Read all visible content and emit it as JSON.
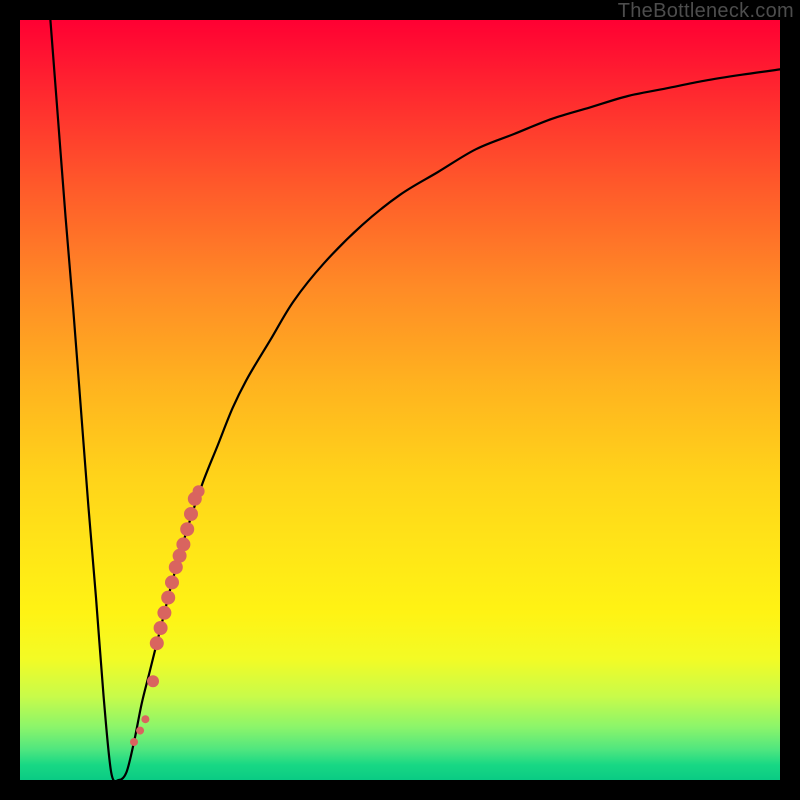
{
  "watermark": "TheBottleneck.com",
  "chart_data": {
    "type": "line",
    "title": "",
    "xlabel": "",
    "ylabel": "",
    "xlim": [
      0,
      100
    ],
    "ylim": [
      0,
      100
    ],
    "x": [
      4,
      5,
      6,
      7,
      8,
      9,
      10,
      11,
      12,
      13,
      14,
      15,
      16,
      17,
      18,
      19,
      20,
      22,
      24,
      26,
      28,
      30,
      33,
      36,
      40,
      45,
      50,
      55,
      60,
      65,
      70,
      75,
      80,
      85,
      90,
      95,
      100
    ],
    "y": [
      100,
      87,
      74,
      62,
      49,
      36,
      24,
      11,
      1,
      0,
      1,
      5,
      10,
      14,
      18,
      22,
      26,
      33,
      39,
      44,
      49,
      53,
      58,
      63,
      68,
      73,
      77,
      80,
      83,
      85,
      87,
      88.5,
      90,
      91,
      92,
      92.8,
      93.5
    ],
    "overlay_points": {
      "x": [
        15.0,
        15.8,
        16.5,
        17.5,
        18.0,
        18.5,
        19.0,
        19.5,
        20.0,
        20.5,
        21.0,
        21.5,
        22.0,
        22.5,
        23.0,
        23.5
      ],
      "y": [
        5,
        6.5,
        8,
        13,
        18,
        20,
        22,
        24,
        26,
        28,
        29.5,
        31,
        33,
        35,
        37,
        38
      ],
      "radius_px": [
        4,
        4,
        4,
        6,
        7,
        7,
        7,
        7,
        7,
        7,
        7,
        7,
        7,
        7,
        7,
        6
      ]
    }
  },
  "colors": {
    "curve": "#000000",
    "points": "#d9645f"
  }
}
